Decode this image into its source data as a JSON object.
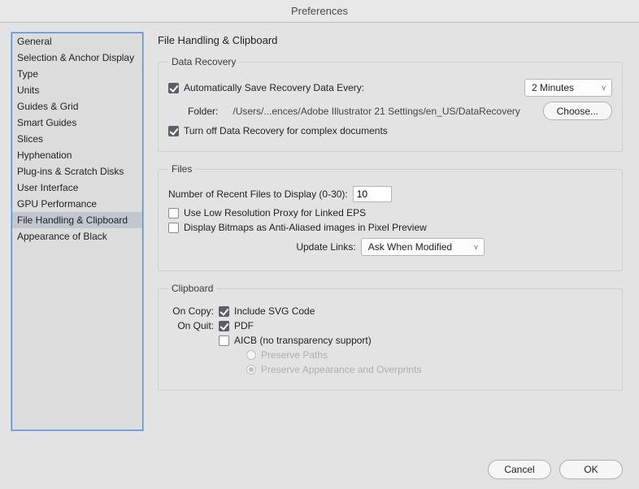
{
  "window": {
    "title": "Preferences"
  },
  "sidebar": {
    "items": [
      "General",
      "Selection & Anchor Display",
      "Type",
      "Units",
      "Guides & Grid",
      "Smart Guides",
      "Slices",
      "Hyphenation",
      "Plug-ins & Scratch Disks",
      "User Interface",
      "GPU Performance",
      "File Handling & Clipboard",
      "Appearance of Black"
    ],
    "selected_index": 11
  },
  "main": {
    "title": "File Handling & Clipboard",
    "data_recovery": {
      "legend": "Data Recovery",
      "auto_save_label": "Automatically Save Recovery Data Every:",
      "auto_save_checked": true,
      "interval_value": "2 Minutes",
      "folder_label": "Folder:",
      "folder_path": "/Users/...ences/Adobe Illustrator 21 Settings/en_US/DataRecovery",
      "choose_label": "Choose...",
      "turn_off_label": "Turn off Data Recovery for complex documents",
      "turn_off_checked": true
    },
    "files": {
      "legend": "Files",
      "recent_label": "Number of Recent Files to Display (0-30):",
      "recent_value": "10",
      "low_res_label": "Use Low Resolution Proxy for Linked EPS",
      "low_res_checked": false,
      "bitmap_label": "Display Bitmaps as Anti-Aliased images in Pixel Preview",
      "bitmap_checked": false,
      "update_links_label": "Update Links:",
      "update_links_value": "Ask When Modified"
    },
    "clipboard": {
      "legend": "Clipboard",
      "on_copy_label": "On Copy:",
      "include_svg_label": "Include SVG Code",
      "include_svg_checked": true,
      "on_quit_label": "On Quit:",
      "pdf_label": "PDF",
      "pdf_checked": true,
      "aicb_label": "AICB (no transparency support)",
      "aicb_checked": false,
      "preserve_paths_label": "Preserve Paths",
      "preserve_appearance_label": "Preserve Appearance and Overprints"
    }
  },
  "footer": {
    "cancel": "Cancel",
    "ok": "OK"
  }
}
